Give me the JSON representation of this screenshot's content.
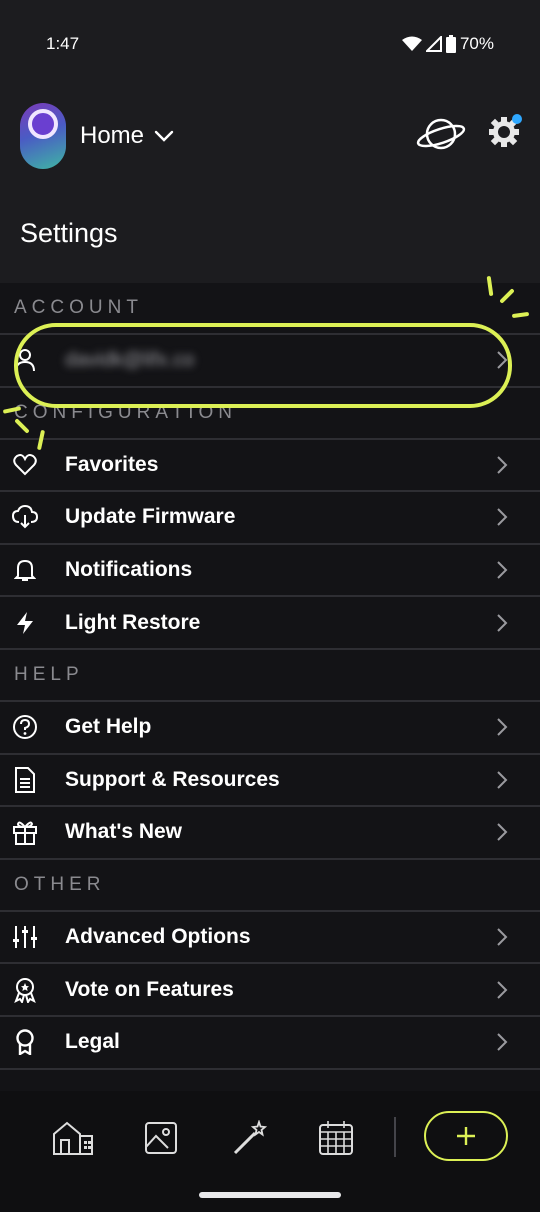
{
  "status": {
    "time": "1:47",
    "battery": "70%"
  },
  "header": {
    "home_label": "Home"
  },
  "page_title": "Settings",
  "sections": [
    {
      "title": "ACCOUNT",
      "items": [
        {
          "label": "davidk@lifx.co",
          "icon": "user-icon",
          "blurred": true
        }
      ]
    },
    {
      "title": "CONFIGURATION",
      "items": [
        {
          "label": "Favorites",
          "icon": "heart-icon"
        },
        {
          "label": "Update Firmware",
          "icon": "cloud-download-icon"
        },
        {
          "label": "Notifications",
          "icon": "bell-icon"
        },
        {
          "label": "Light Restore",
          "icon": "bolt-icon"
        }
      ]
    },
    {
      "title": "HELP",
      "items": [
        {
          "label": "Get Help",
          "icon": "question-icon"
        },
        {
          "label": "Support & Resources",
          "icon": "document-icon"
        },
        {
          "label": "What's New",
          "icon": "gift-icon"
        }
      ]
    },
    {
      "title": "OTHER",
      "items": [
        {
          "label": "Advanced Options",
          "icon": "sliders-icon"
        },
        {
          "label": "Vote on Features",
          "icon": "award-icon"
        },
        {
          "label": "Legal",
          "icon": "ribbon-icon"
        }
      ]
    }
  ],
  "bottom_nav": [
    "home-icon",
    "image-icon",
    "magic-wand-icon",
    "calendar-icon",
    "plus-icon"
  ],
  "colors": {
    "accent": "#dcf055",
    "background": "#1c1c1f",
    "list_bg": "#131316"
  }
}
